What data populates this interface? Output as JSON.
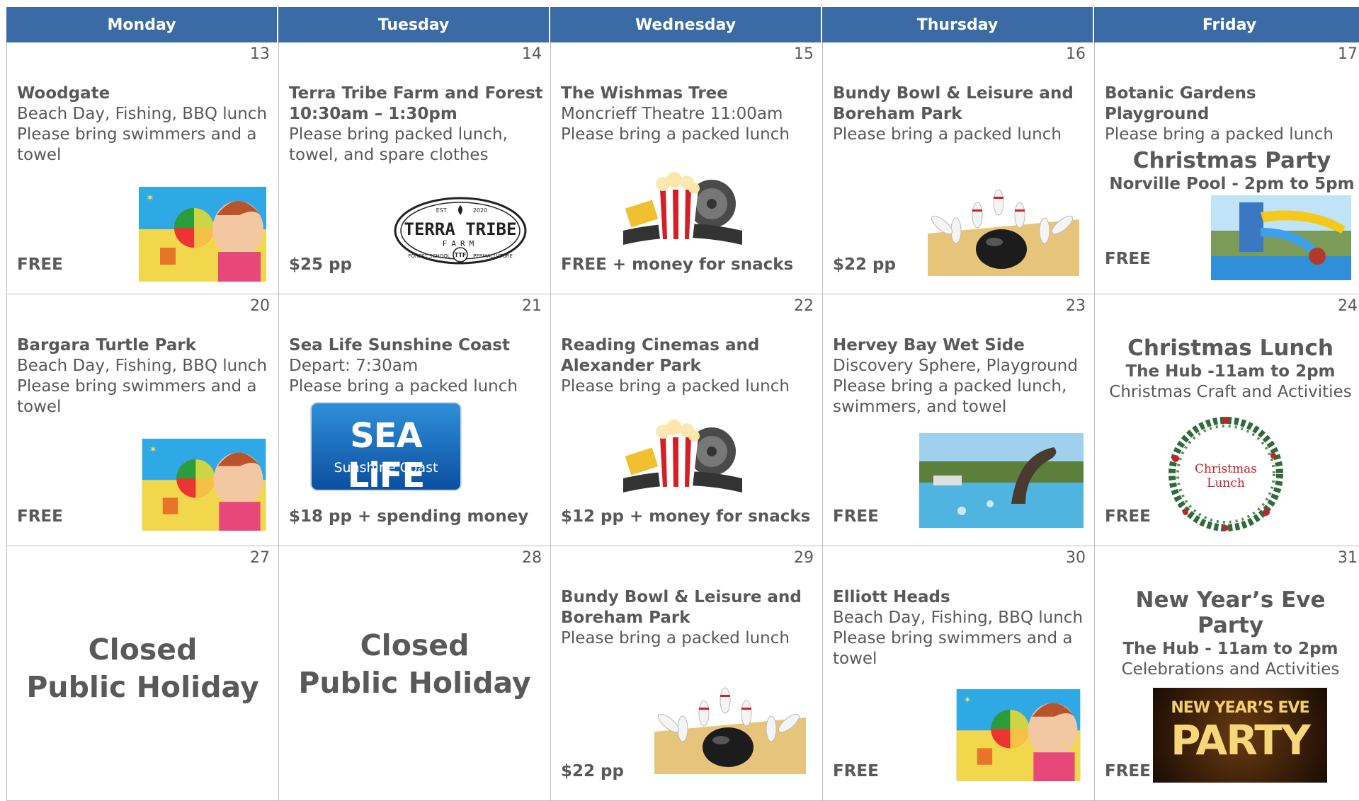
{
  "days": [
    "Monday",
    "Tuesday",
    "Wednesday",
    "Thursday",
    "Friday"
  ],
  "cells": [
    {
      "day": "13",
      "title": "Woodgate",
      "lines": [
        "Beach Day, Fishing, BBQ lunch",
        "Please bring swimmers and a towel"
      ],
      "price": "FREE"
    },
    {
      "day": "14",
      "title": "Terra Tribe Farm and Forest",
      "bold_line": "10:30am – 1:30pm",
      "lines": [
        "Please bring packed lunch, towel, and spare clothes"
      ],
      "price": "$25 pp",
      "logo": {
        "top": "EST.",
        "year": "2020",
        "name": "TERRA TRIBE",
        "sub": "FARM",
        "left": "FOREST SCHOOL",
        "right": "PERMACULTURE",
        "badge": "TTF"
      }
    },
    {
      "day": "15",
      "title": "The Wishmas Tree",
      "lines": [
        "Moncrieff Theatre 11:00am",
        "Please bring a packed lunch"
      ],
      "price": "FREE + money for snacks"
    },
    {
      "day": "16",
      "title": "Bundy Bowl & Leisure and Boreham Park",
      "lines": [
        "Please bring a packed lunch"
      ],
      "price": "$22 pp"
    },
    {
      "day": "17",
      "title": "Botanic Gardens Playground",
      "lines": [
        "Please bring a packed lunch"
      ],
      "event": "Christmas Party",
      "event_sub": "Norville Pool - 2pm to 5pm",
      "price": "FREE"
    },
    {
      "day": "20",
      "title": "Bargara Turtle Park",
      "lines": [
        "Beach Day, Fishing, BBQ lunch",
        "Please bring swimmers and a towel"
      ],
      "price": "FREE"
    },
    {
      "day": "21",
      "title": "Sea Life Sunshine Coast",
      "lines": [
        "Depart: 7:30am",
        "Please bring a packed lunch"
      ],
      "price": "$18 pp + spending money",
      "logo": {
        "name": "SEA LiFE",
        "sub": "Sunshine Coast"
      }
    },
    {
      "day": "22",
      "title": "Reading Cinemas and Alexander Park",
      "lines": [
        "Please bring a packed lunch"
      ],
      "price": "$12 pp + money for snacks"
    },
    {
      "day": "23",
      "title": "Hervey Bay Wet Side",
      "lines": [
        "Discovery Sphere, Playground",
        "Please bring a packed lunch, swimmers, and towel"
      ],
      "price": "FREE"
    },
    {
      "day": "24",
      "event": "Christmas Lunch",
      "event_sub": "The Hub -11am to 2pm",
      "lines": [
        "Christmas Craft and Activities"
      ],
      "price": "FREE",
      "wreath": "Christmas Lunch"
    },
    {
      "day": "27",
      "closed": [
        "Closed",
        "Public Holiday"
      ]
    },
    {
      "day": "28",
      "closed": [
        "Closed",
        "Public Holiday"
      ]
    },
    {
      "day": "29",
      "title": "Bundy Bowl & Leisure and Boreham Park",
      "lines": [
        "Please bring a packed lunch"
      ],
      "price": "$22 pp"
    },
    {
      "day": "30",
      "title": "Elliott Heads",
      "lines": [
        "Beach Day, Fishing, BBQ lunch",
        "Please bring swimmers and a towel"
      ],
      "price": "FREE"
    },
    {
      "day": "31",
      "event": "New Year’s Eve Party",
      "event_sub": "The Hub - 11am to 2pm",
      "lines": [
        "Celebrations and Activities"
      ],
      "price": "FREE",
      "banner": [
        "NEW YEAR’S EVE",
        "PARTY"
      ]
    }
  ],
  "colors": {
    "header": "#3a6ba5",
    "text": "#595959",
    "border": "#bfbfbf"
  }
}
